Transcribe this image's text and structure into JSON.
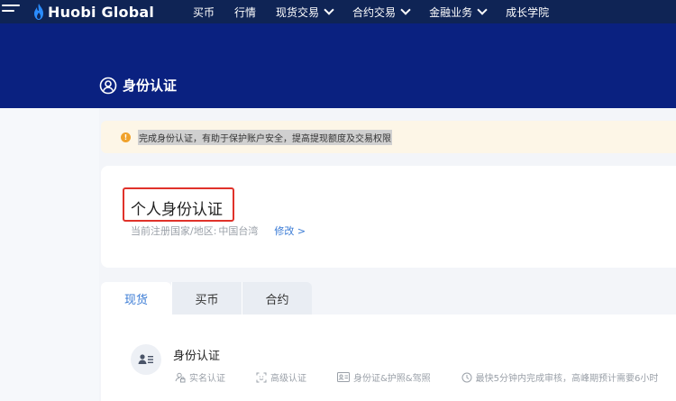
{
  "nav": {
    "logo_text": "Huobi Global",
    "items": [
      {
        "label": "买币",
        "has_dropdown": false
      },
      {
        "label": "行情",
        "has_dropdown": false
      },
      {
        "label": "现货交易",
        "has_dropdown": true
      },
      {
        "label": "合约交易",
        "has_dropdown": true
      },
      {
        "label": "金融业务",
        "has_dropdown": true
      },
      {
        "label": "成长学院",
        "has_dropdown": false
      }
    ]
  },
  "page": {
    "title": "身份认证"
  },
  "notice": {
    "icon": "!",
    "text": "完成身份认证，有助于保护账户安全，提高提现额度及交易权限"
  },
  "card": {
    "title": "个人身份认证",
    "country_label": "当前注册国家/地区:",
    "country_value": "中国台湾",
    "modify_link": "修改 >"
  },
  "tabs": [
    {
      "label": "现货",
      "active": true
    },
    {
      "label": "买币",
      "active": false
    },
    {
      "label": "合约",
      "active": false
    }
  ],
  "panel": {
    "title": "身份认证",
    "features": [
      {
        "icon": "user-lock-icon",
        "label": "实名认证"
      },
      {
        "icon": "face-scan-icon",
        "label": "高级认证"
      },
      {
        "icon": "id-card-icon",
        "label": "身份证&护照&驾照"
      },
      {
        "icon": "clock-icon",
        "label": "最快5分钟内完成审核，高峰期预计需要6小时"
      }
    ]
  },
  "colors": {
    "nav_bg": "#0f2455",
    "banner_bg": "#0a2180",
    "accent": "#3a7bd5",
    "warning": "#f0a22b",
    "highlight_border": "#e0322a"
  }
}
